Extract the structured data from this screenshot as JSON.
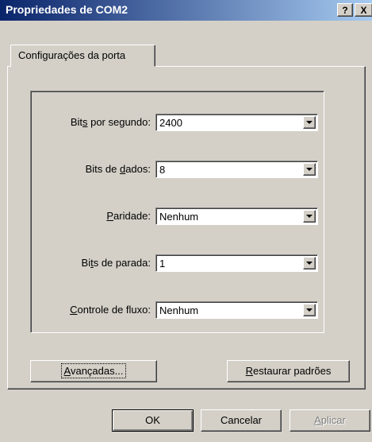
{
  "window": {
    "title": "Propriedades de COM2",
    "help_label": "?",
    "close_label": "X"
  },
  "tabs": [
    {
      "label": "Configurações da porta"
    }
  ],
  "fields": {
    "bits_por_segundo": {
      "label_pre": "Bit",
      "label_u": "s",
      "label_post": " por segundo:",
      "value": "2400"
    },
    "bits_de_dados": {
      "label_pre": "Bits de ",
      "label_u": "d",
      "label_post": "ados:",
      "value": "8"
    },
    "paridade": {
      "label_pre": "",
      "label_u": "P",
      "label_post": "aridade:",
      "value": "Nenhum"
    },
    "bits_de_parada": {
      "label_pre": "Bi",
      "label_u": "t",
      "label_post": "s de parada:",
      "value": "1"
    },
    "controle_de_fluxo": {
      "label_pre": "",
      "label_u": "C",
      "label_post": "ontrole de fluxo:",
      "value": "Nenhum"
    }
  },
  "buttons": {
    "avancadas": {
      "pre": "",
      "u": "A",
      "post": "vançadas..."
    },
    "restaurar": {
      "pre": "",
      "u": "R",
      "post": "estaurar padrões"
    },
    "ok": "OK",
    "cancelar": "Cancelar",
    "aplicar": {
      "pre": "",
      "u": "A",
      "post": "plicar"
    }
  }
}
